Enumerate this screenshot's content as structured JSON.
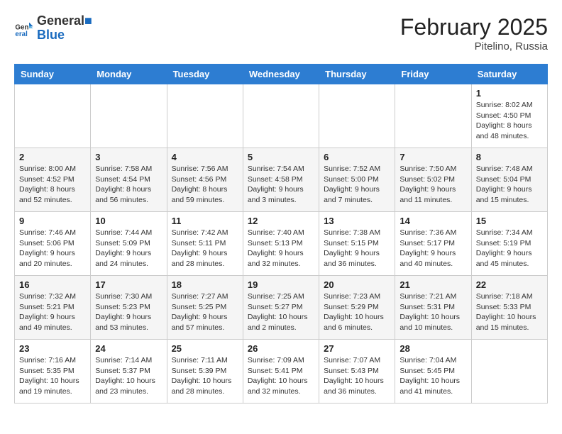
{
  "header": {
    "logo_line1": "General",
    "logo_line2": "Blue",
    "month": "February 2025",
    "location": "Pitelino, Russia"
  },
  "weekdays": [
    "Sunday",
    "Monday",
    "Tuesday",
    "Wednesday",
    "Thursday",
    "Friday",
    "Saturday"
  ],
  "weeks": [
    [
      {
        "day": "",
        "info": ""
      },
      {
        "day": "",
        "info": ""
      },
      {
        "day": "",
        "info": ""
      },
      {
        "day": "",
        "info": ""
      },
      {
        "day": "",
        "info": ""
      },
      {
        "day": "",
        "info": ""
      },
      {
        "day": "1",
        "info": "Sunrise: 8:02 AM\nSunset: 4:50 PM\nDaylight: 8 hours\nand 48 minutes."
      }
    ],
    [
      {
        "day": "2",
        "info": "Sunrise: 8:00 AM\nSunset: 4:52 PM\nDaylight: 8 hours\nand 52 minutes."
      },
      {
        "day": "3",
        "info": "Sunrise: 7:58 AM\nSunset: 4:54 PM\nDaylight: 8 hours\nand 56 minutes."
      },
      {
        "day": "4",
        "info": "Sunrise: 7:56 AM\nSunset: 4:56 PM\nDaylight: 8 hours\nand 59 minutes."
      },
      {
        "day": "5",
        "info": "Sunrise: 7:54 AM\nSunset: 4:58 PM\nDaylight: 9 hours\nand 3 minutes."
      },
      {
        "day": "6",
        "info": "Sunrise: 7:52 AM\nSunset: 5:00 PM\nDaylight: 9 hours\nand 7 minutes."
      },
      {
        "day": "7",
        "info": "Sunrise: 7:50 AM\nSunset: 5:02 PM\nDaylight: 9 hours\nand 11 minutes."
      },
      {
        "day": "8",
        "info": "Sunrise: 7:48 AM\nSunset: 5:04 PM\nDaylight: 9 hours\nand 15 minutes."
      }
    ],
    [
      {
        "day": "9",
        "info": "Sunrise: 7:46 AM\nSunset: 5:06 PM\nDaylight: 9 hours\nand 20 minutes."
      },
      {
        "day": "10",
        "info": "Sunrise: 7:44 AM\nSunset: 5:09 PM\nDaylight: 9 hours\nand 24 minutes."
      },
      {
        "day": "11",
        "info": "Sunrise: 7:42 AM\nSunset: 5:11 PM\nDaylight: 9 hours\nand 28 minutes."
      },
      {
        "day": "12",
        "info": "Sunrise: 7:40 AM\nSunset: 5:13 PM\nDaylight: 9 hours\nand 32 minutes."
      },
      {
        "day": "13",
        "info": "Sunrise: 7:38 AM\nSunset: 5:15 PM\nDaylight: 9 hours\nand 36 minutes."
      },
      {
        "day": "14",
        "info": "Sunrise: 7:36 AM\nSunset: 5:17 PM\nDaylight: 9 hours\nand 40 minutes."
      },
      {
        "day": "15",
        "info": "Sunrise: 7:34 AM\nSunset: 5:19 PM\nDaylight: 9 hours\nand 45 minutes."
      }
    ],
    [
      {
        "day": "16",
        "info": "Sunrise: 7:32 AM\nSunset: 5:21 PM\nDaylight: 9 hours\nand 49 minutes."
      },
      {
        "day": "17",
        "info": "Sunrise: 7:30 AM\nSunset: 5:23 PM\nDaylight: 9 hours\nand 53 minutes."
      },
      {
        "day": "18",
        "info": "Sunrise: 7:27 AM\nSunset: 5:25 PM\nDaylight: 9 hours\nand 57 minutes."
      },
      {
        "day": "19",
        "info": "Sunrise: 7:25 AM\nSunset: 5:27 PM\nDaylight: 10 hours\nand 2 minutes."
      },
      {
        "day": "20",
        "info": "Sunrise: 7:23 AM\nSunset: 5:29 PM\nDaylight: 10 hours\nand 6 minutes."
      },
      {
        "day": "21",
        "info": "Sunrise: 7:21 AM\nSunset: 5:31 PM\nDaylight: 10 hours\nand 10 minutes."
      },
      {
        "day": "22",
        "info": "Sunrise: 7:18 AM\nSunset: 5:33 PM\nDaylight: 10 hours\nand 15 minutes."
      }
    ],
    [
      {
        "day": "23",
        "info": "Sunrise: 7:16 AM\nSunset: 5:35 PM\nDaylight: 10 hours\nand 19 minutes."
      },
      {
        "day": "24",
        "info": "Sunrise: 7:14 AM\nSunset: 5:37 PM\nDaylight: 10 hours\nand 23 minutes."
      },
      {
        "day": "25",
        "info": "Sunrise: 7:11 AM\nSunset: 5:39 PM\nDaylight: 10 hours\nand 28 minutes."
      },
      {
        "day": "26",
        "info": "Sunrise: 7:09 AM\nSunset: 5:41 PM\nDaylight: 10 hours\nand 32 minutes."
      },
      {
        "day": "27",
        "info": "Sunrise: 7:07 AM\nSunset: 5:43 PM\nDaylight: 10 hours\nand 36 minutes."
      },
      {
        "day": "28",
        "info": "Sunrise: 7:04 AM\nSunset: 5:45 PM\nDaylight: 10 hours\nand 41 minutes."
      },
      {
        "day": "",
        "info": ""
      }
    ]
  ]
}
